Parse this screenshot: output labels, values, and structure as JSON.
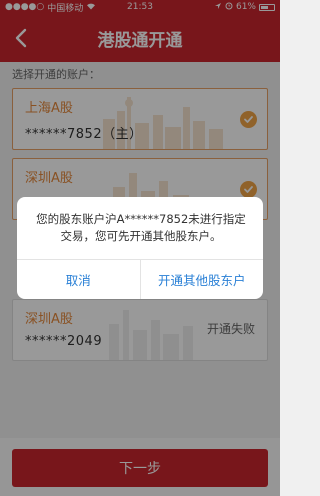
{
  "status_bar": {
    "carrier": "中国移动",
    "time": "21:53",
    "battery": "61%",
    "battery_level": 0.61
  },
  "nav": {
    "title": "港股通开通",
    "back_icon": "chevron-left-icon"
  },
  "section_label": "选择开通的账户：",
  "accounts": [
    {
      "name": "上海A股",
      "number": "******7852（主）",
      "selected": true
    },
    {
      "name": "深圳A股",
      "number": "",
      "selected": true
    },
    {
      "name": "深圳A股",
      "number": "******2049",
      "status": "开通失败",
      "selected": false
    }
  ],
  "next_button": "下一步",
  "dialog": {
    "message": "您的股东账户沪A******7852未进行指定交易，您可先开通其他股东户。",
    "cancel": "取消",
    "confirm": "开通其他股东户"
  },
  "colors": {
    "brand": "#c9252e",
    "accent": "#e4883b",
    "link": "#2a80d6"
  }
}
